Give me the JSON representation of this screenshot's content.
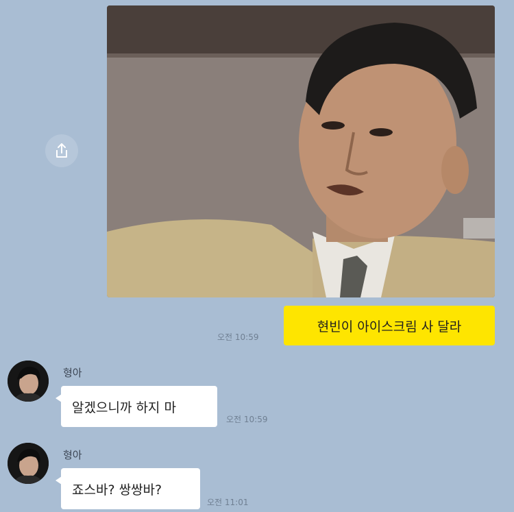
{
  "messages": {
    "outgoing": {
      "text": "현빈이 아이스크림 사 달라",
      "time": "오전 10:59"
    },
    "incoming_1": {
      "sender": "형아",
      "text": "알겠으니까 하지 마",
      "time": "오전 10:59"
    },
    "incoming_2": {
      "sender": "형아",
      "text": "죠스바? 쌍쌍바?",
      "time": "오전 11:01"
    }
  },
  "colors": {
    "background": "#a9bdd3",
    "outgoing_bubble": "#fee500",
    "incoming_bubble": "#ffffff"
  },
  "icons": {
    "share": "share-icon"
  }
}
